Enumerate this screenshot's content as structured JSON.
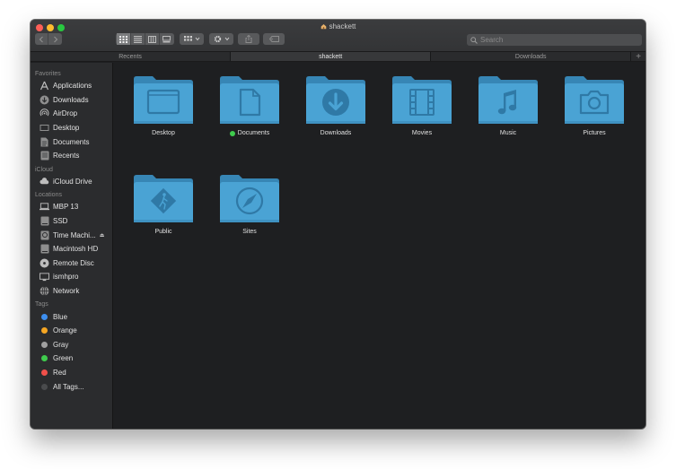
{
  "window": {
    "title": "shackett"
  },
  "toolbar": {
    "search_placeholder": "Search"
  },
  "tabs": [
    {
      "label": "Recents",
      "active": false
    },
    {
      "label": "shackett",
      "active": true
    },
    {
      "label": "Downloads",
      "active": false
    }
  ],
  "tab_add_label": "+",
  "sidebar": {
    "favorites_title": "Favorites",
    "favorites": [
      {
        "label": "Applications",
        "icon": "applications-icon"
      },
      {
        "label": "Downloads",
        "icon": "downloads-icon"
      },
      {
        "label": "AirDrop",
        "icon": "airdrop-icon"
      },
      {
        "label": "Desktop",
        "icon": "desktop-icon"
      },
      {
        "label": "Documents",
        "icon": "documents-icon"
      },
      {
        "label": "Recents",
        "icon": "recents-icon"
      }
    ],
    "icloud_title": "iCloud",
    "icloud": [
      {
        "label": "iCloud Drive",
        "icon": "cloud-icon"
      }
    ],
    "locations_title": "Locations",
    "locations": [
      {
        "label": "MBP 13",
        "icon": "laptop-icon"
      },
      {
        "label": "SSD",
        "icon": "drive-icon"
      },
      {
        "label": "Time Machi...",
        "icon": "time-machine-icon"
      },
      {
        "label": "Macintosh HD",
        "icon": "drive-icon"
      },
      {
        "label": "Remote Disc",
        "icon": "disc-icon"
      },
      {
        "label": "ismhpro",
        "icon": "monitor-icon"
      },
      {
        "label": "Network",
        "icon": "network-icon"
      }
    ],
    "eject_glyph": "⏏",
    "tags_title": "Tags",
    "tags": [
      {
        "label": "Blue",
        "color": "#3d8ff0"
      },
      {
        "label": "Orange",
        "color": "#f5a623"
      },
      {
        "label": "Gray",
        "color": "#a0a0a0"
      },
      {
        "label": "Green",
        "color": "#3fcb4d"
      },
      {
        "label": "Red",
        "color": "#f0504a"
      },
      {
        "label": "All Tags...",
        "color": "#4a4b4d"
      }
    ]
  },
  "folders": [
    {
      "label": "Desktop",
      "icon": "desktop-glyph"
    },
    {
      "label": "Documents",
      "icon": "document-glyph",
      "tag_color": "#3fcb4d"
    },
    {
      "label": "Downloads",
      "icon": "download-glyph"
    },
    {
      "label": "Movies",
      "icon": "film-glyph"
    },
    {
      "label": "Music",
      "icon": "music-glyph"
    },
    {
      "label": "Pictures",
      "icon": "camera-glyph"
    },
    {
      "label": "Public",
      "icon": "public-glyph"
    },
    {
      "label": "Sites",
      "icon": "compass-glyph"
    }
  ],
  "colors": {
    "folder_front": "#4aa3d4",
    "folder_back": "#3786b5",
    "folder_glyph": "#2b6f9b"
  }
}
